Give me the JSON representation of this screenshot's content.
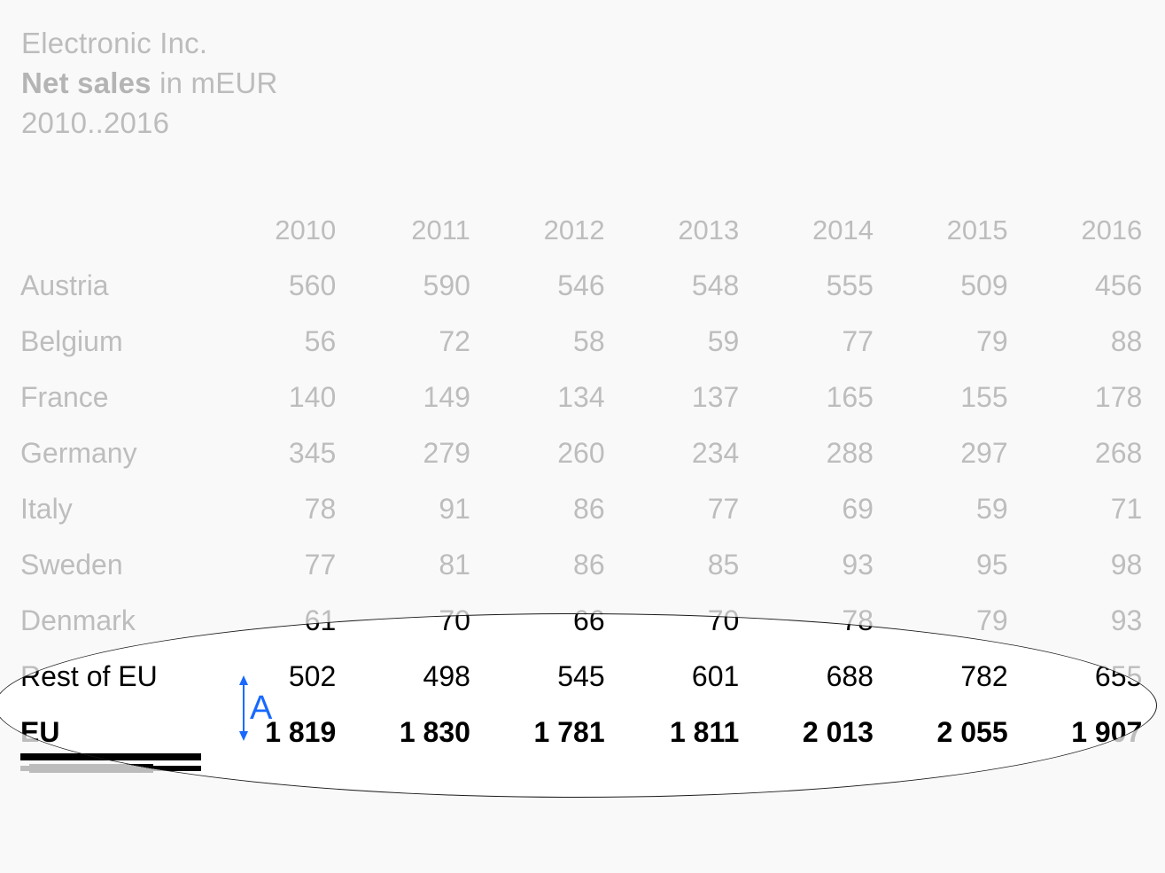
{
  "title": {
    "company": "Electronic Inc.",
    "metric_bold": "Net sales",
    "metric_rest": " in mEUR",
    "period": "2010..2016"
  },
  "colors": {
    "background": "#f9f9f9",
    "muted_text": "#bdbdbd",
    "emphasis_text": "#000000",
    "rule": "#d7d7d7",
    "bar": "#bcbcbc",
    "annotation_blue": "#1769ff",
    "highlight_fill": "#ffffff",
    "highlight_stroke": "#1a1a1a"
  },
  "table": {
    "corner_label": "",
    "columns": [
      "2010",
      "2011",
      "2012",
      "2013",
      "2014",
      "2015",
      "2016"
    ],
    "column_rule_styles": [
      "thick",
      "thick",
      "thick",
      "thick",
      "thick",
      "double",
      "double"
    ],
    "rows": [
      {
        "label": "Austria",
        "values": [
          "560",
          "590",
          "546",
          "548",
          "555",
          "509",
          "456"
        ],
        "style": "normal"
      },
      {
        "label": "Belgium",
        "values": [
          "56",
          "72",
          "58",
          "59",
          "77",
          "79",
          "88"
        ],
        "style": "normal"
      },
      {
        "label": "France",
        "values": [
          "140",
          "149",
          "134",
          "137",
          "165",
          "155",
          "178"
        ],
        "style": "normal"
      },
      {
        "label": "Germany",
        "values": [
          "345",
          "279",
          "260",
          "234",
          "288",
          "297",
          "268"
        ],
        "style": "normal"
      },
      {
        "label": "Italy",
        "values": [
          "78",
          "91",
          "86",
          "77",
          "69",
          "59",
          "71"
        ],
        "style": "normal"
      },
      {
        "label": "Sweden",
        "values": [
          "77",
          "81",
          "86",
          "85",
          "93",
          "95",
          "98"
        ],
        "style": "normal"
      },
      {
        "label": "Denmark",
        "values": [
          "61",
          "70",
          "66",
          "70",
          "78",
          "79",
          "93"
        ],
        "style": "normal"
      },
      {
        "label": "Rest of EU",
        "values": [
          "502",
          "498",
          "545",
          "601",
          "688",
          "782",
          "655"
        ],
        "style": "subtotal-rule"
      },
      {
        "label": "EU",
        "values": [
          "1 819",
          "1 830",
          "1 781",
          "1 811",
          "2 013",
          "2 055",
          "1 907"
        ],
        "style": "total"
      }
    ],
    "total_rule_styles": [
      "thick",
      "thick",
      "thick",
      "thick",
      "thick",
      "double",
      "double"
    ]
  },
  "annotation": {
    "label": "A",
    "kind": "double-headed-vertical-arrow",
    "target_row": "Rest of EU"
  },
  "highlight": {
    "shape": "ellipse",
    "covers_rows": [
      "Denmark",
      "Rest of EU",
      "EU"
    ]
  }
}
